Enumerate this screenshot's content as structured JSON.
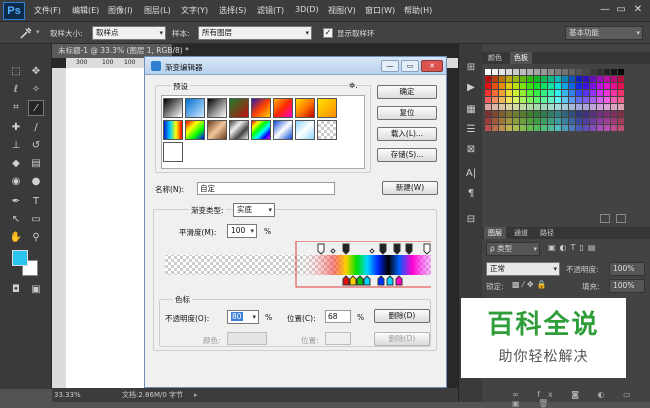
{
  "app": {
    "logo": "Ps"
  },
  "menu": [
    "文件(F)",
    "编辑(E)",
    "图像(I)",
    "图层(L)",
    "文字(Y)",
    "选择(S)",
    "滤镜(T)",
    "3D(D)",
    "视图(V)",
    "窗口(W)",
    "帮助(H)"
  ],
  "window_controls": {
    "minimize": "—",
    "restore": "▭",
    "close": "✕"
  },
  "options": {
    "sample_size_label": "取样大小:",
    "sample_size_value": "取样点",
    "sample_label": "样本:",
    "sample_value": "所有图层",
    "show_ring_label": "显示取样环",
    "workspace": "基本功能"
  },
  "document": {
    "tab_title": "未标题-1 @ 33.3% (图层 1, RGB/8) *",
    "ruler_ticks": [
      "300",
      "100",
      "100"
    ]
  },
  "status": {
    "zoom": "33.33%",
    "doc_info": "文档:2.86M/0 字节"
  },
  "right_panel": {
    "tabs_top": [
      "颜色",
      "色板"
    ],
    "tabs_layers": [
      "图层",
      "通道",
      "路径"
    ],
    "kind_filter": "ρ 类型",
    "blend_mode": "正常",
    "opacity_label": "不透明度:",
    "opacity_value": "100%",
    "lock_label": "锁定:",
    "fill_label": "填充:",
    "fill_value": "100%"
  },
  "dialog": {
    "title": "渐变编辑器",
    "presets_label": "预设",
    "presets_menu": "✲.",
    "ok": "确定",
    "reset": "复位",
    "load": "载入(L)...",
    "save": "存储(S)...",
    "name_label": "名称(N):",
    "name_value": "自定",
    "new_button": "新建(W)",
    "gradient_type_label": "渐变类型:",
    "gradient_type_value": "实底",
    "smoothness_label": "平滑度(M):",
    "smoothness_value": "100",
    "percent": "%",
    "stops_group_label": "色标",
    "opacity_label": "不透明度(O):",
    "opacity_value": "80",
    "location_label": "位置(C):",
    "location_value": "68",
    "delete_button": "删除(D)",
    "color_label": "颜色:",
    "color_location_label": "位置:",
    "color_delete_button": "删除(D)"
  },
  "watermark": {
    "title": "百科全说",
    "subtitle": "助你轻松解决"
  },
  "colors": {
    "accent": "#3d7fd6",
    "fg_swatch": "#2bc3f0",
    "bg_swatch": "#ffffff",
    "highlight_box": "#e03a3a",
    "watermark_green": "#2f9e3a"
  }
}
